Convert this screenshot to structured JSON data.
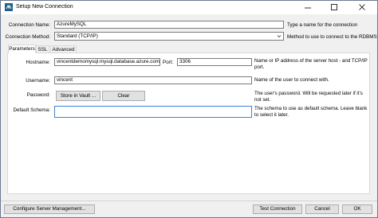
{
  "window": {
    "title": "Setup New Connection",
    "controls": {
      "minimize_icon": "minimize-icon",
      "maximize_icon": "maximize-icon",
      "close_icon": "close-icon"
    }
  },
  "connection": {
    "name_label": "Connection Name:",
    "name_value": "AzureMySQL",
    "name_hint": "Type a name for the connection",
    "method_label": "Connection Method:",
    "method_value": "Standard (TCP/IP)",
    "method_hint": "Method to use to connect to the RDBMS"
  },
  "tabs": [
    {
      "label": "Parameters",
      "active": true
    },
    {
      "label": "SSL",
      "active": false
    },
    {
      "label": "Advanced",
      "active": false
    }
  ],
  "parameters": {
    "hostname_label": "Hostname:",
    "hostname_value": "vincentdemomysql.mysql.database.azure.com",
    "port_label": "Port:",
    "port_value": "3306",
    "hostname_hint": "Name or IP address of the server host - and TCP/IP port.",
    "username_label": "Username:",
    "username_value": "vincent",
    "username_hint": "Name of the user to connect with.",
    "password_label": "Password:",
    "store_button": "Store in Vault ...",
    "clear_button": "Clear",
    "password_hint": "The user's password. Will be requested later if it's not set.",
    "schema_label": "Default Schema:",
    "schema_value": "",
    "schema_hint": "The schema to use as default schema. Leave blank to select it later."
  },
  "footer": {
    "configure_button": "Configure Server Management...",
    "test_button": "Test Connection",
    "cancel_button": "Cancel",
    "ok_button": "OK"
  },
  "colors": {
    "focus_border": "#3b83d8",
    "window_bg": "#f0f0f0",
    "panel_bg": "#ffffff"
  }
}
